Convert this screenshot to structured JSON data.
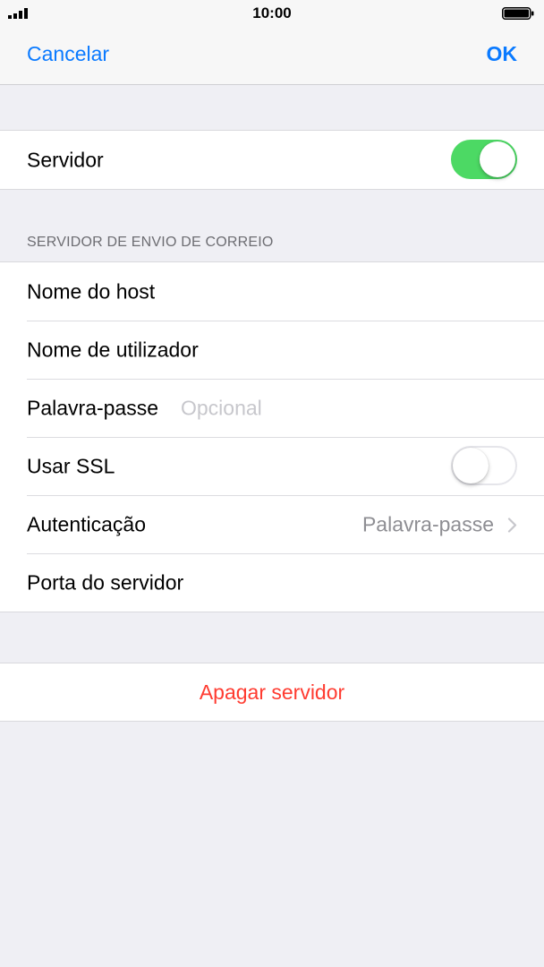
{
  "status_bar": {
    "time": "10:00",
    "signal_icon": "signal-bars-icon",
    "battery_icon": "battery-icon"
  },
  "nav": {
    "cancel_label": "Cancelar",
    "ok_label": "OK",
    "accent_color": "#0a7aff"
  },
  "server_toggle": {
    "label": "Servidor",
    "on": true,
    "on_color": "#4cd964"
  },
  "outgoing_section": {
    "header": "SERVIDOR DE ENVIO DE CORREIO",
    "host_label": "Nome do host",
    "username_label": "Nome de utilizador",
    "password_label": "Palavra-passe",
    "password_placeholder": "Opcional",
    "ssl_label": "Usar SSL",
    "ssl_on": false,
    "auth_label": "Autenticação",
    "auth_value": "Palavra-passe",
    "auth_icon": "chevron-right-icon",
    "port_label": "Porta do servidor"
  },
  "delete_button": {
    "label": "Apagar servidor",
    "color": "#ff3b30"
  }
}
